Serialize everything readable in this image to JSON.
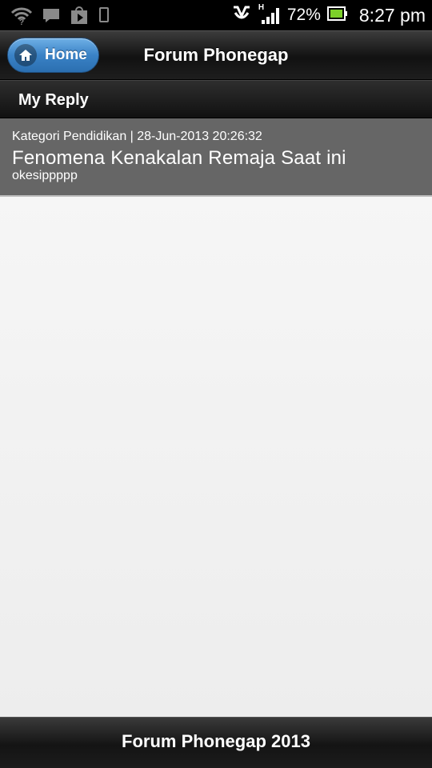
{
  "status_bar": {
    "battery_percent": "72%",
    "time": "8:27 pm",
    "network_label": "H",
    "icons": [
      "wifi-icon",
      "message-icon",
      "play-store-icon",
      "phone-icon",
      "usb-debug-icon",
      "signal-icon",
      "battery-icon"
    ]
  },
  "header": {
    "home_label": "Home",
    "title": "Forum Phonegap"
  },
  "section": {
    "title": "My Reply"
  },
  "replies": [
    {
      "meta": "Kategori Pendidikan | 28-Jun-2013 20:26:32",
      "title": "Fenomena Kenakalan Remaja Saat ini",
      "body": "okesippppp"
    }
  ],
  "footer": {
    "text": "Forum Phonegap 2013"
  },
  "colors": {
    "home_button": "#3a82c6",
    "reply_bg": "#666666",
    "content_bg": "#f2f2f2",
    "bar_bg": "#1a1a1a"
  }
}
